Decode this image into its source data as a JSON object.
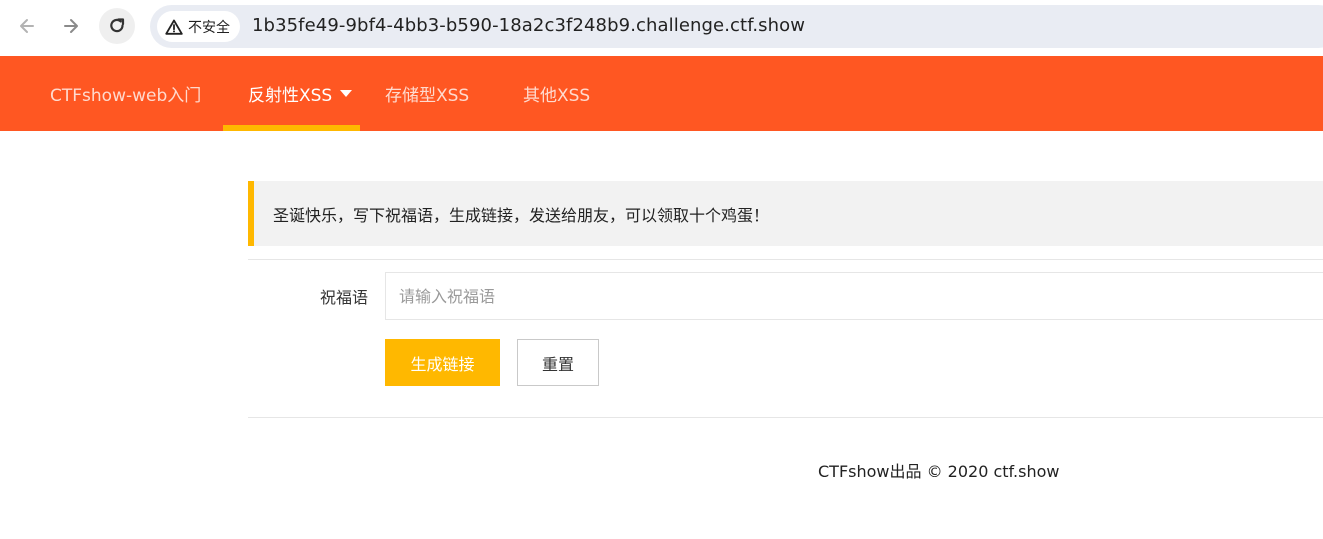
{
  "browser": {
    "back_icon": "arrow-left-icon",
    "forward_icon": "arrow-right-icon",
    "reload_icon": "reload-icon",
    "security_label": "不安全",
    "security_icon": "warning-triangle-icon",
    "url": "1b35fe49-9bf4-4bb3-b590-18a2c3f248b9.challenge.ctf.show"
  },
  "header": {
    "nav": [
      {
        "label": "CTFshow-web入门",
        "active": false
      },
      {
        "label": "反射性XSS",
        "active": true,
        "has_dropdown": true
      },
      {
        "label": "存储型XSS",
        "active": false
      },
      {
        "label": "其他XSS",
        "active": false
      }
    ]
  },
  "notice": {
    "text": "圣诞快乐，写下祝福语，生成链接，发送给朋友，可以领取十个鸡蛋！"
  },
  "form": {
    "label": "祝福语",
    "placeholder": "请输入祝福语",
    "value": "",
    "submit_label": "生成链接",
    "reset_label": "重置"
  },
  "footer": {
    "text": "CTFshow出品 © 2020 ctf.show"
  },
  "colors": {
    "header_bg": "#ff5722",
    "accent": "#ffb800",
    "notice_bg": "#f2f2f2"
  }
}
